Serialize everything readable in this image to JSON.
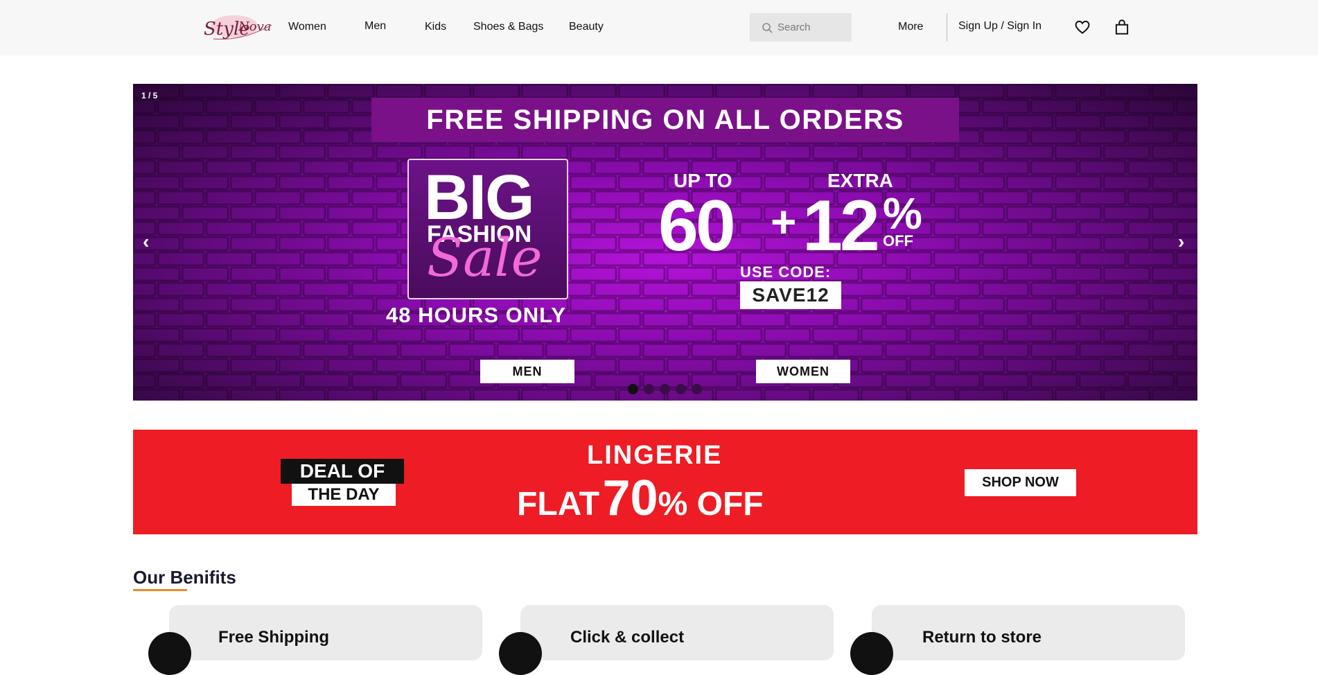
{
  "header": {
    "logo_text": "StyleNova",
    "nav": [
      "Women",
      "Men",
      "Kids",
      "Shoes & Bags",
      "Beauty"
    ],
    "search_placeholder": "Search",
    "more": "More",
    "signin": "Sign Up / Sign In"
  },
  "hero": {
    "counter": "1 / 5",
    "prev": "‹",
    "next": "›",
    "free_shipping": "FREE SHIPPING ON ALL ORDERS",
    "big": "BIG",
    "fashion": "FASHION",
    "sale": "Sale",
    "hours": "48 HOURS ONLY",
    "up_to": "UP TO",
    "extra": "EXTRA",
    "first_discount": "60",
    "plus": "+",
    "second_discount": "12",
    "percent": "%",
    "off": "OFF",
    "use_code": "USE CODE:",
    "code": "SAVE12",
    "cta_men": "MEN",
    "cta_women": "WOMEN",
    "slide_count": 5,
    "active_slide": 1
  },
  "deal": {
    "badge_line1": "DEAL OF",
    "badge_line2": "THE DAY",
    "title": "LINGERIE",
    "flat": "FLAT",
    "value": "70",
    "suffix": "% OFF",
    "shop_now": "SHOP NOW"
  },
  "benefits": {
    "title": "Our Benifits",
    "items": [
      "Free Shipping",
      "Click & collect",
      "Return to store"
    ]
  },
  "colors": {
    "accent_purple": "#8a0cae",
    "deal_red": "#ee1c24",
    "underline_orange": "#f08a24"
  }
}
